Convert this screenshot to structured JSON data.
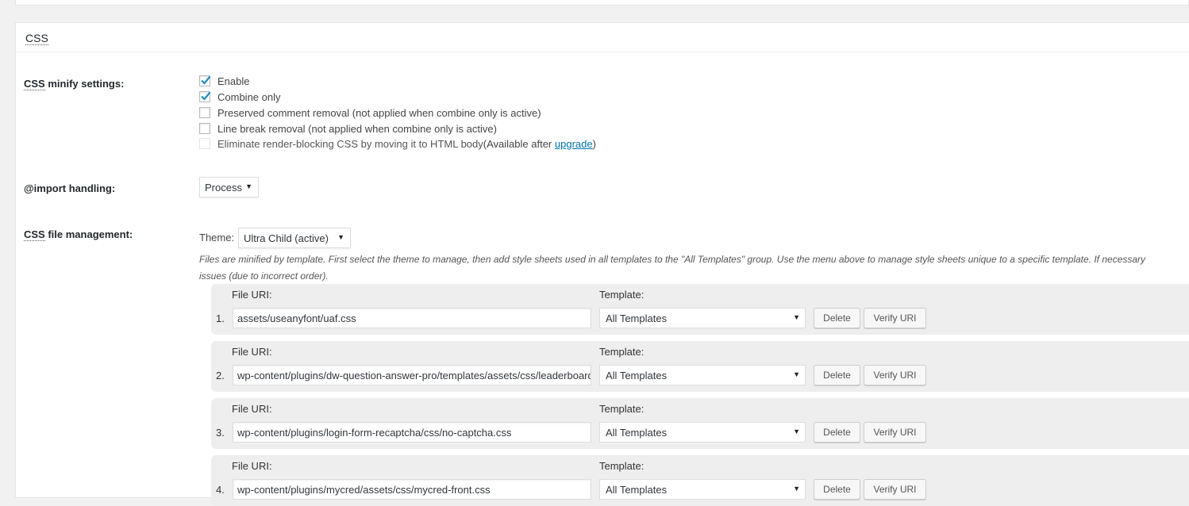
{
  "section": {
    "title": "CSS"
  },
  "minify": {
    "label_abbr": "CSS",
    "label_rest": " minify settings:",
    "options": [
      {
        "label": "Enable",
        "checked": true
      },
      {
        "label": "Combine only",
        "checked": true
      },
      {
        "label": "Preserved comment removal (not applied when combine only is active)",
        "checked": false
      },
      {
        "label": "Line break removal (not applied when combine only is active)",
        "checked": false
      }
    ],
    "render_blocking": {
      "label": "Eliminate render-blocking CSS by moving it to HTML body",
      "note_pre": " (Available after ",
      "link": "upgrade",
      "note_post": ")"
    }
  },
  "import_handling": {
    "label": "@import handling:",
    "value": "Process"
  },
  "file_management": {
    "label_abbr": "CSS",
    "label_rest": " file management:",
    "theme_label": "Theme:",
    "theme_value": "Ultra Child (active)",
    "description_line1": "Files are minified by template. First select the theme to manage, then add style sheets used in all templates to the \"All Templates\" group. Use the menu above to manage style sheets unique to a specific template. If necessary",
    "description_line2": "issues (due to incorrect order).",
    "file_uri_label": "File URI:",
    "template_label": "Template:",
    "delete_label": "Delete",
    "verify_label": "Verify URI",
    "files": [
      {
        "num": "1.",
        "uri": "assets/useanyfont/uaf.css",
        "template": "All Templates"
      },
      {
        "num": "2.",
        "uri": "wp-content/plugins/dw-question-answer-pro/templates/assets/css/leaderboard.css",
        "template": "All Templates"
      },
      {
        "num": "3.",
        "uri": "wp-content/plugins/login-form-recaptcha/css/no-captcha.css",
        "template": "All Templates"
      },
      {
        "num": "4.",
        "uri": "wp-content/plugins/mycred/assets/css/mycred-front.css",
        "template": "All Templates"
      }
    ]
  }
}
